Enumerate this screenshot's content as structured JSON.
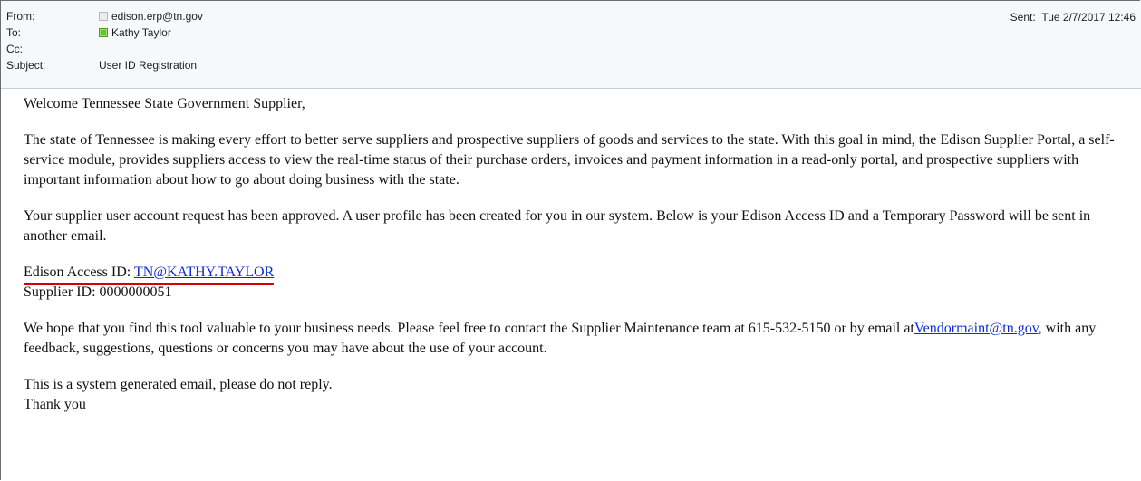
{
  "header": {
    "from_label": "From:",
    "from_value": "edison.erp@tn.gov",
    "to_label": "To:",
    "to_value": "Kathy Taylor",
    "cc_label": "Cc:",
    "cc_value": "",
    "subject_label": "Subject:",
    "subject_value": "User ID Registration",
    "sent_label": "Sent:",
    "sent_value": "Tue 2/7/2017 12:46"
  },
  "body": {
    "greeting": "Welcome Tennessee State Government Supplier,",
    "para1": "The state of Tennessee is making every effort to better serve suppliers and prospective suppliers of goods and services to the state. With this goal in mind, the Edison Supplier Portal, a self-service module, provides suppliers access to view the real-time status of their purchase orders, invoices and payment information in a read-only portal, and prospective suppliers with important information about how to go about doing business with the state.",
    "para2": "Your supplier user account request has been approved. A user profile has been created for you in our system. Below is your Edison Access ID and a Temporary Password will be sent in another email.",
    "access_id_label": "Edison Access ID: ",
    "access_id_value": "TN@KATHY.TAYLOR",
    "supplier_id_line": "Supplier ID: 0000000051",
    "para3_start": "We hope that you find this tool valuable to your business needs. Please feel free to contact the Supplier Maintenance team at 615-532-5150 or by email at",
    "email_link": "Vendormaint@tn.gov",
    "para3_end": ", with any feedback, suggestions, questions or concerns you may have about the use of your account.",
    "closing1": "This is a system generated email, please do not reply.",
    "closing2": "Thank you"
  },
  "icons": {
    "from_icon": "contact-card-icon",
    "to_icon": "presence-available-icon"
  },
  "colors": {
    "link": "#0b2bd6",
    "highlight_underline": "#d40000",
    "header_bg": "#f6f8fc"
  }
}
